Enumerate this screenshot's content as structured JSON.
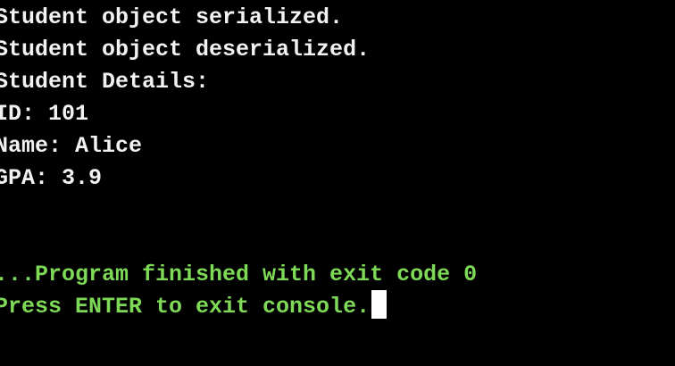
{
  "terminal": {
    "output_lines": [
      "Student object serialized.",
      "Student object deserialized.",
      "Student Details:",
      "ID: 101",
      "Name: Alice",
      "GPA: 3.9"
    ],
    "status_lines": [
      "...Program finished with exit code 0",
      "Press ENTER to exit console."
    ],
    "colors": {
      "background": "#000000",
      "output_text": "#f2f2f2",
      "status_text": "#7ed957",
      "cursor": "#ffffff"
    }
  }
}
